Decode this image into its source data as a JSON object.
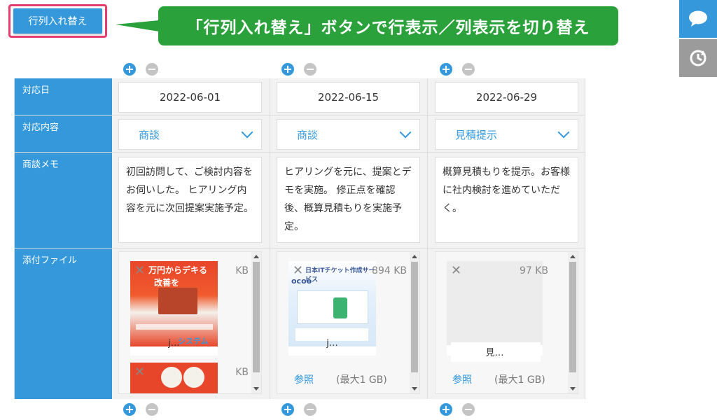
{
  "toolbar": {
    "toggle_label": "行列入れ替え"
  },
  "callout": {
    "text": "「行列入れ替え」ボタンで行表示／列表示を切り替え"
  },
  "side": {
    "comment_icon": "speech-bubble-icon",
    "history_icon": "history-icon"
  },
  "controls": {
    "plus": "+",
    "minus": "−"
  },
  "rows": {
    "date": "対応日",
    "type": "対応内容",
    "memo": "商談メモ",
    "files": "添付ファイル"
  },
  "records": [
    {
      "date": "2022-06-01",
      "type": "商談",
      "memo": "初回訪問して、ご検討内容をお伺いした。\nヒアリング内容を元に次回提案実施予定。",
      "files": [
        {
          "size": "KB",
          "name": "j…"
        },
        {
          "size": "KB",
          "name": ""
        }
      ],
      "ref": "",
      "max": ""
    },
    {
      "date": "2022-06-15",
      "type": "商談",
      "memo": "ヒアリングを元に、提案とデモを実施。\n修正点を確認後、概算見積もりを実施予定。",
      "files": [
        {
          "size": "894 KB",
          "name": "j…"
        }
      ],
      "ref": "参照",
      "max": "(最大1 GB)"
    },
    {
      "date": "2022-06-29",
      "type": "見積提示",
      "memo": "概算見積もりを提示。お客様に社内検討を進めていただく。",
      "files": [
        {
          "size": "97 KB",
          "name": "見…"
        }
      ],
      "ref": "参照",
      "max": "(最大1 GB)"
    }
  ],
  "flyer_text": {
    "line1": "万円からデキる",
    "line2": "改善を",
    "line3": "システム"
  },
  "web_text": {
    "header": "日本ITチケット作成サービス",
    "logo": "ocoo"
  }
}
